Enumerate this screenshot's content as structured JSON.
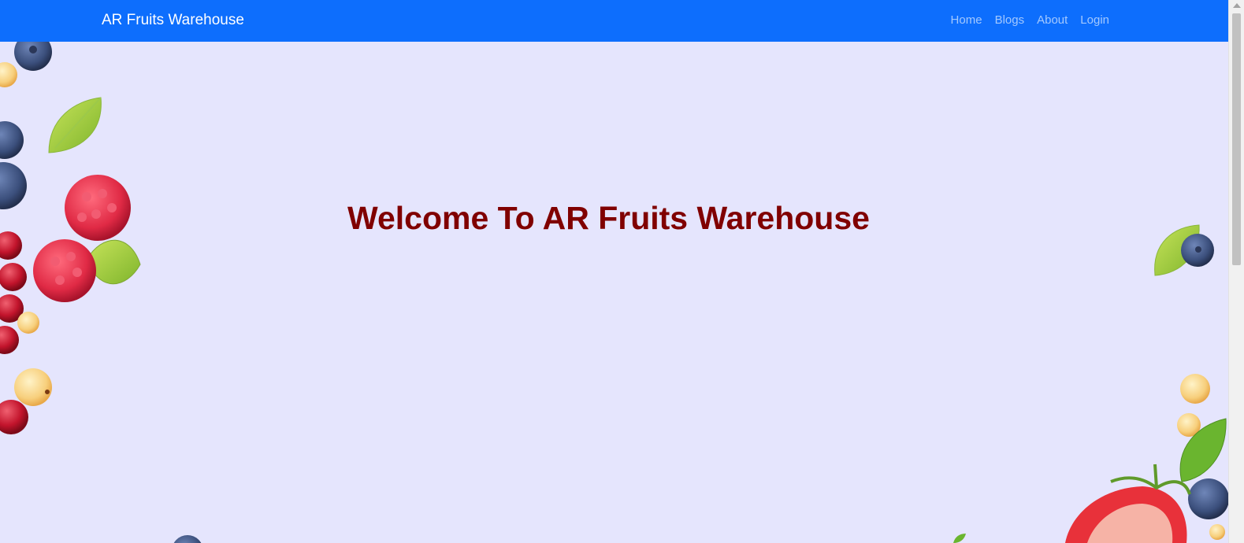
{
  "navbar": {
    "brand": "AR Fruits Warehouse",
    "links": [
      "Home",
      "Blogs",
      "About",
      "Login"
    ]
  },
  "hero": {
    "title": "Welcome To AR Fruits Warehouse"
  },
  "colors": {
    "navbar_bg": "#0d6efd",
    "page_bg": "#e5e5fd",
    "title": "#800000"
  },
  "icons": {
    "decorations": [
      "blueberry",
      "raspberry",
      "red-currant",
      "mint-leaf",
      "white-currant",
      "strawberry"
    ]
  }
}
